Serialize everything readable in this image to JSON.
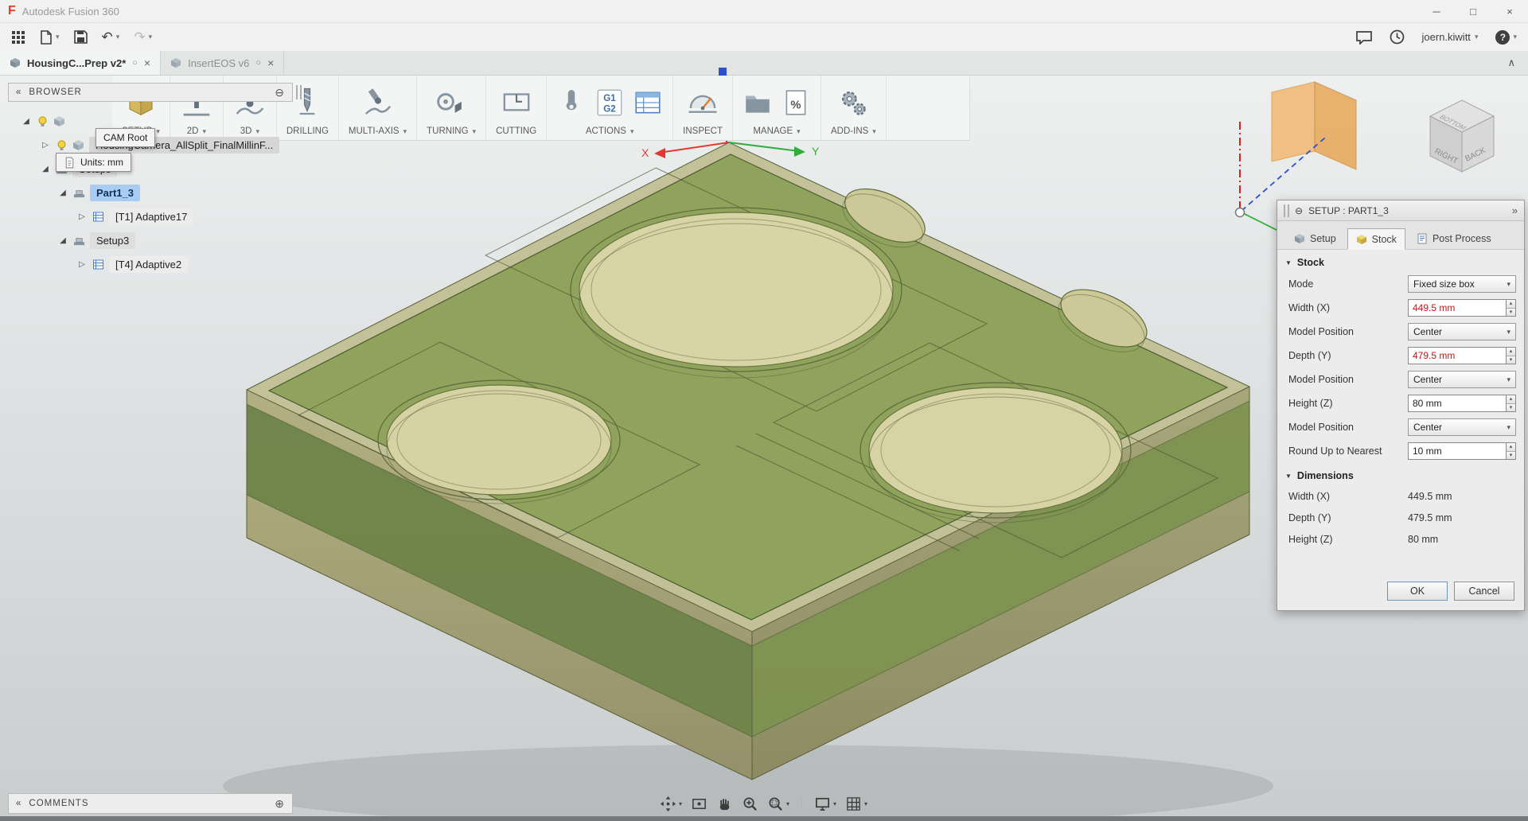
{
  "titlebar": {
    "app_title": "Autodesk Fusion 360"
  },
  "icons": {
    "logo": "F",
    "minimize": "─",
    "maximize": "□",
    "close": "×",
    "chevron_down": "▾",
    "undo": "↶",
    "redo": "↷",
    "help": "?",
    "sync": "○",
    "tab_close": "×",
    "collapse_up": "∧",
    "double_left": "«",
    "minus_circle": "⊖",
    "plus_circle": "⊕",
    "double_right": "»",
    "caret_down": "▼",
    "expanded": "◢",
    "collapsed": "▷",
    "spin_up": "▴",
    "spin_down": "▾"
  },
  "toolbar": {
    "user": "joern.kiwitt"
  },
  "tabs": [
    {
      "label": "HousingC...Prep v2*"
    },
    {
      "label": "InsertEOS v6"
    }
  ],
  "ribbon": {
    "groups": [
      {
        "label": "SETUP"
      },
      {
        "label": "2D"
      },
      {
        "label": "3D"
      },
      {
        "label": "DRILLING"
      },
      {
        "label": "MULTI-AXIS"
      },
      {
        "label": "TURNING"
      },
      {
        "label": "CUTTING"
      },
      {
        "label": "ACTIONS"
      },
      {
        "label": "INSPECT"
      },
      {
        "label": "MANAGE"
      },
      {
        "label": "ADD-INS"
      }
    ],
    "g1": "G1",
    "g2": "G2",
    "percent": "%"
  },
  "browser": {
    "title": "BROWSER",
    "tooltip_title": "CAM Root",
    "tooltip_units": "Units: mm",
    "items": [
      {
        "label": "HousingCamera_AllSplit_FinalMillinF..."
      },
      {
        "label": "Setups"
      },
      {
        "label": "Part1_3"
      },
      {
        "label": "[T1] Adaptive17"
      },
      {
        "label": "Setup3"
      },
      {
        "label": "[T4] Adaptive2"
      }
    ]
  },
  "viewcube": {
    "right": "RIGHT",
    "back": "BACK",
    "bottom": "BOTTOM"
  },
  "axes": {
    "x": "X",
    "y": "Y"
  },
  "dialog": {
    "title": "SETUP : PART1_3",
    "tabs": [
      {
        "label": "Setup"
      },
      {
        "label": "Stock"
      },
      {
        "label": "Post Process"
      }
    ],
    "sections": {
      "stock": "Stock",
      "dimensions": "Dimensions"
    },
    "rows": [
      {
        "label": "Mode",
        "value": "Fixed size box"
      },
      {
        "label": "Width (X)",
        "value": "449.5 mm"
      },
      {
        "label": "Model Position",
        "value": "Center"
      },
      {
        "label": "Depth (Y)",
        "value": "479.5 mm"
      },
      {
        "label": "Model Position",
        "value": "Center"
      },
      {
        "label": "Height (Z)",
        "value": "80 mm"
      },
      {
        "label": "Model Position",
        "value": "Center"
      },
      {
        "label": "Round Up to Nearest",
        "value": "10 mm"
      }
    ],
    "dims": [
      {
        "label": "Width (X)",
        "value": "449.5 mm"
      },
      {
        "label": "Depth (Y)",
        "value": "479.5 mm"
      },
      {
        "label": "Height (Z)",
        "value": "80 mm"
      }
    ],
    "ok": "OK",
    "cancel": "Cancel"
  },
  "comments": {
    "title": "COMMENTS"
  },
  "colors": {
    "accent_blue": "#2b52cc",
    "selection": "#a9cdf2",
    "part_green": "#8da25b",
    "stock_tan": "#d7d3a5",
    "error_red": "#cc1111",
    "plane_orange": "#f2b469"
  }
}
